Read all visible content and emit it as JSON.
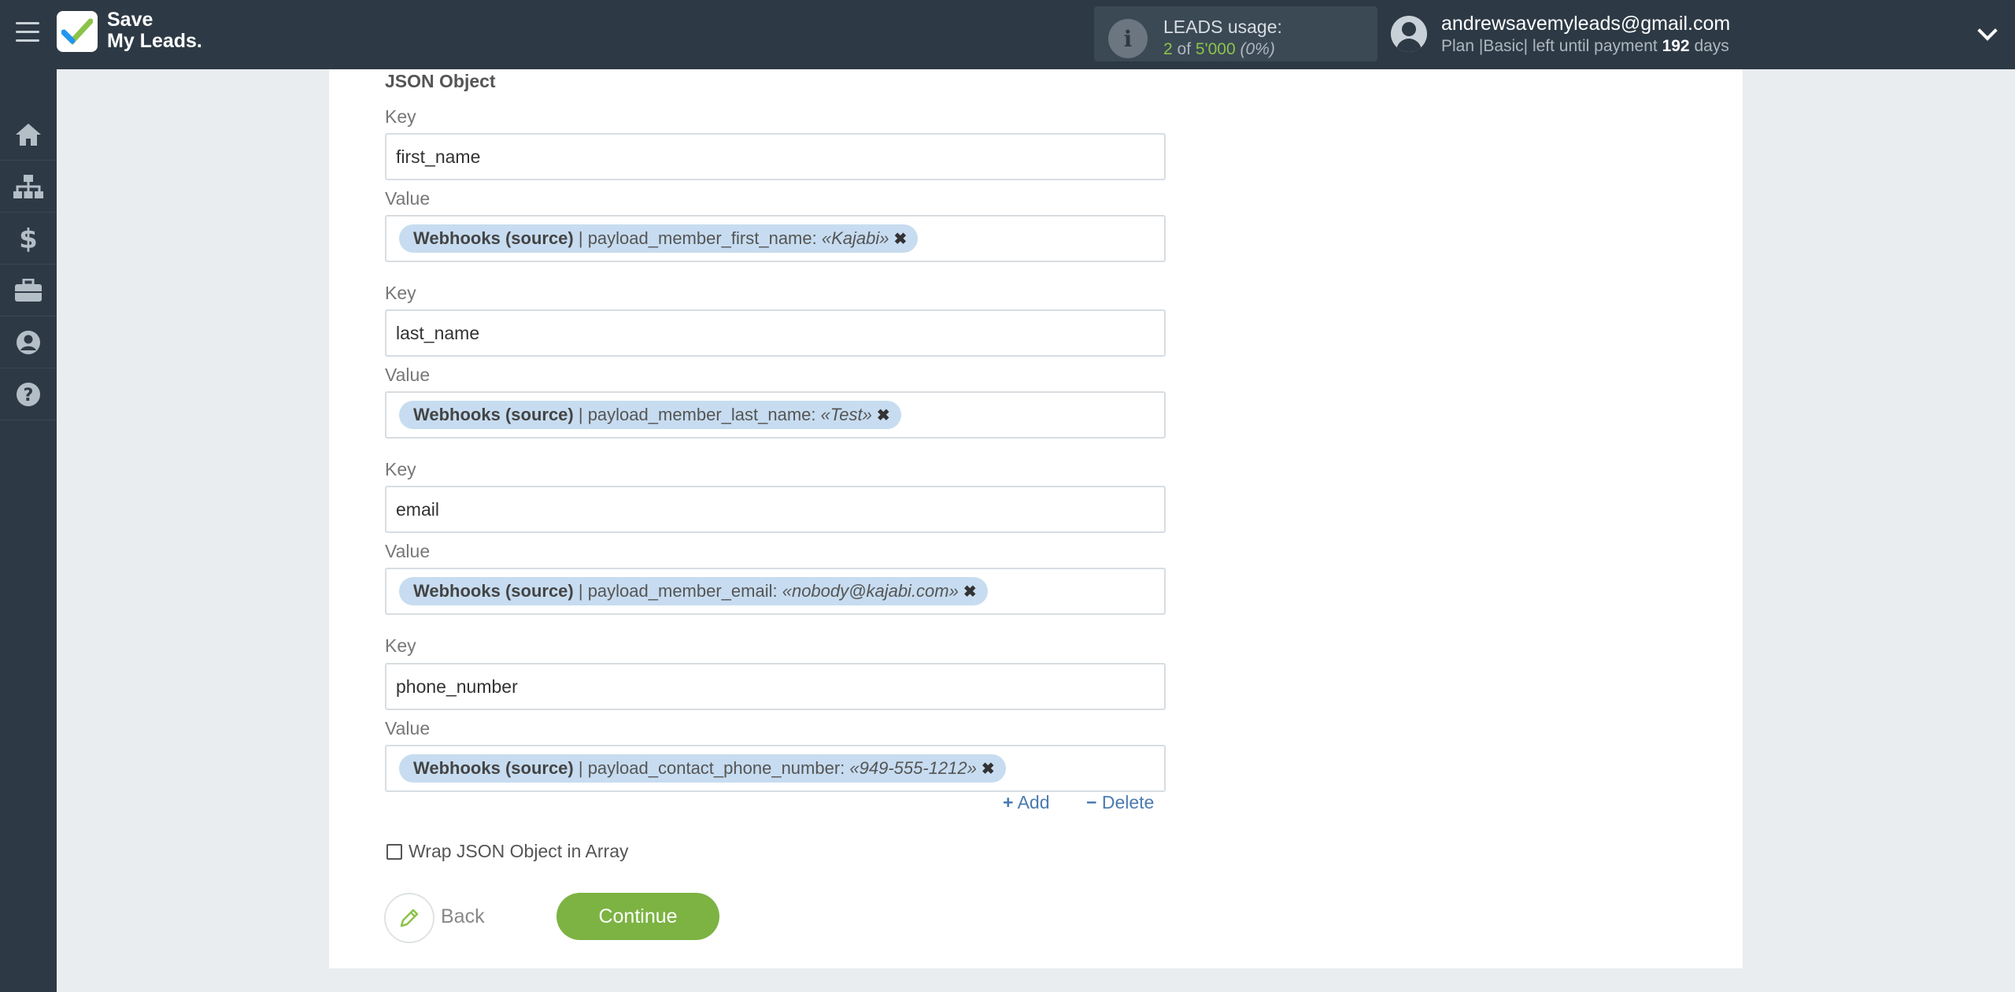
{
  "app": {
    "logo_line1": "Save",
    "logo_line2": "My Leads."
  },
  "usage": {
    "label": "LEADS usage:",
    "used": "2",
    "of": "of",
    "total": "5'000",
    "percent": "(0%)"
  },
  "user": {
    "email": "andrewsavemyleads@gmail.com",
    "plan_prefix": "Plan |Basic| left until payment",
    "days": "192",
    "days_suffix": "days"
  },
  "sidebar": {
    "items": [
      {
        "icon": "home-icon"
      },
      {
        "icon": "sitemap-icon"
      },
      {
        "icon": "dollar-icon"
      },
      {
        "icon": "briefcase-icon"
      },
      {
        "icon": "user-circle-icon"
      },
      {
        "icon": "help-icon"
      }
    ]
  },
  "form": {
    "section_title": "JSON Object",
    "key_label": "Key",
    "value_label": "Value",
    "pairs": [
      {
        "key": "first_name",
        "source": "Webhooks (source)",
        "field": " | payload_member_first_name: ",
        "value": "«Kajabi»"
      },
      {
        "key": "last_name",
        "source": "Webhooks (source)",
        "field": " | payload_member_last_name: ",
        "value": "«Test»"
      },
      {
        "key": "email",
        "source": "Webhooks (source)",
        "field": " | payload_member_email: ",
        "value": "«nobody@kajabi.com»"
      },
      {
        "key": "phone_number",
        "source": "Webhooks (source)",
        "field": " | payload_contact_phone_number: ",
        "value": "«949-555-1212»"
      }
    ],
    "add_label": "Add",
    "delete_label": "Delete",
    "wrap_label": "Wrap JSON Object in Array",
    "wrap_checked": false
  },
  "buttons": {
    "back": "Back",
    "continue": "Continue"
  },
  "colors": {
    "topbar": "#2d3a45",
    "accent_green": "#7cb342",
    "tag_bg": "#c7dcf0",
    "link": "#4a7bb0"
  }
}
